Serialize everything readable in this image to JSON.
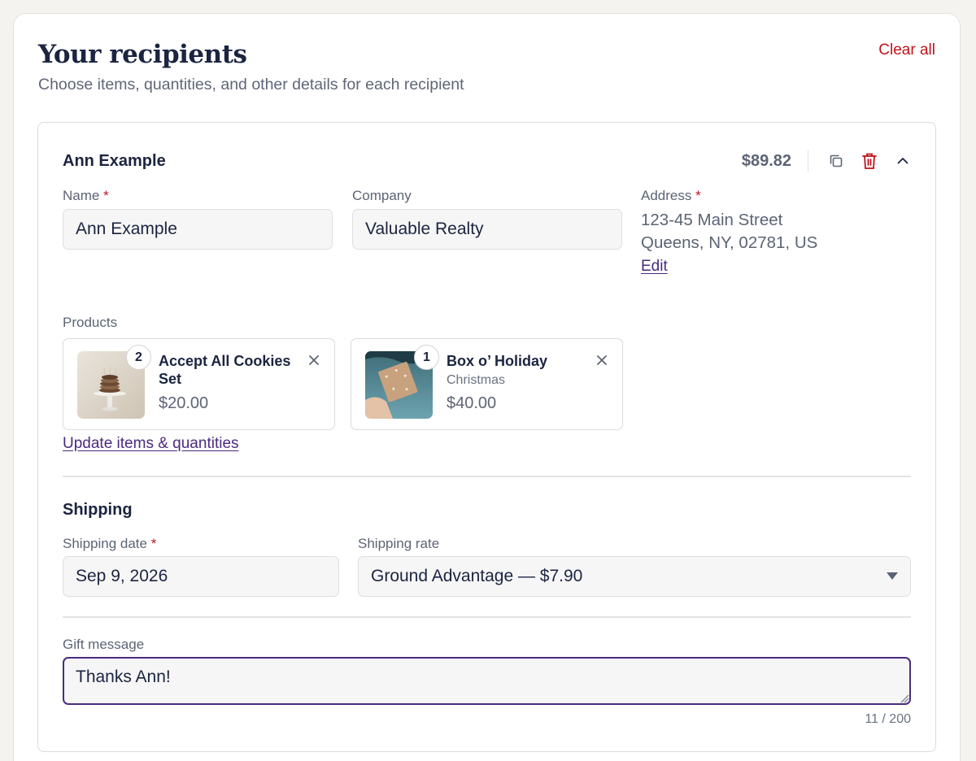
{
  "page": {
    "title": "Your recipients",
    "subtitle": "Choose items, quantities, and other details for each recipient",
    "clear_all_label": "Clear all"
  },
  "recipient": {
    "header_name": "Ann Example",
    "total": "$89.82",
    "actions": {
      "duplicate_icon": "copy-icon",
      "delete_icon": "trash-icon",
      "collapse_icon": "chevron-up-icon"
    },
    "fields": {
      "name_label": "Name",
      "name_value": "Ann Example",
      "company_label": "Company",
      "company_value": "Valuable Realty",
      "address_label": "Address",
      "address_line1": "123-45 Main Street",
      "address_line2": "Queens, NY, 02781, US",
      "edit_label": "Edit",
      "required_mark": "*"
    },
    "products_label": "Products",
    "products": [
      {
        "quantity": "2",
        "name": "Accept All Cookies Set",
        "variant": "",
        "price": "$20.00"
      },
      {
        "quantity": "1",
        "name": "Box o’ Holiday",
        "variant": "Christmas",
        "price": "$40.00"
      }
    ],
    "update_items_label": "Update items & quantities",
    "shipping": {
      "title": "Shipping",
      "date_label": "Shipping date",
      "date_value": "Sep 9, 2026",
      "rate_label": "Shipping rate",
      "rate_value": "Ground Advantage — $7.90"
    },
    "gift": {
      "label": "Gift message",
      "value": "Thanks Ann!",
      "char_count": "11 / 200"
    }
  },
  "colors": {
    "accent_purple": "#4a2c80",
    "danger_red": "#c0121c",
    "text_dark": "#1b2440",
    "text_muted": "#5c6474"
  }
}
